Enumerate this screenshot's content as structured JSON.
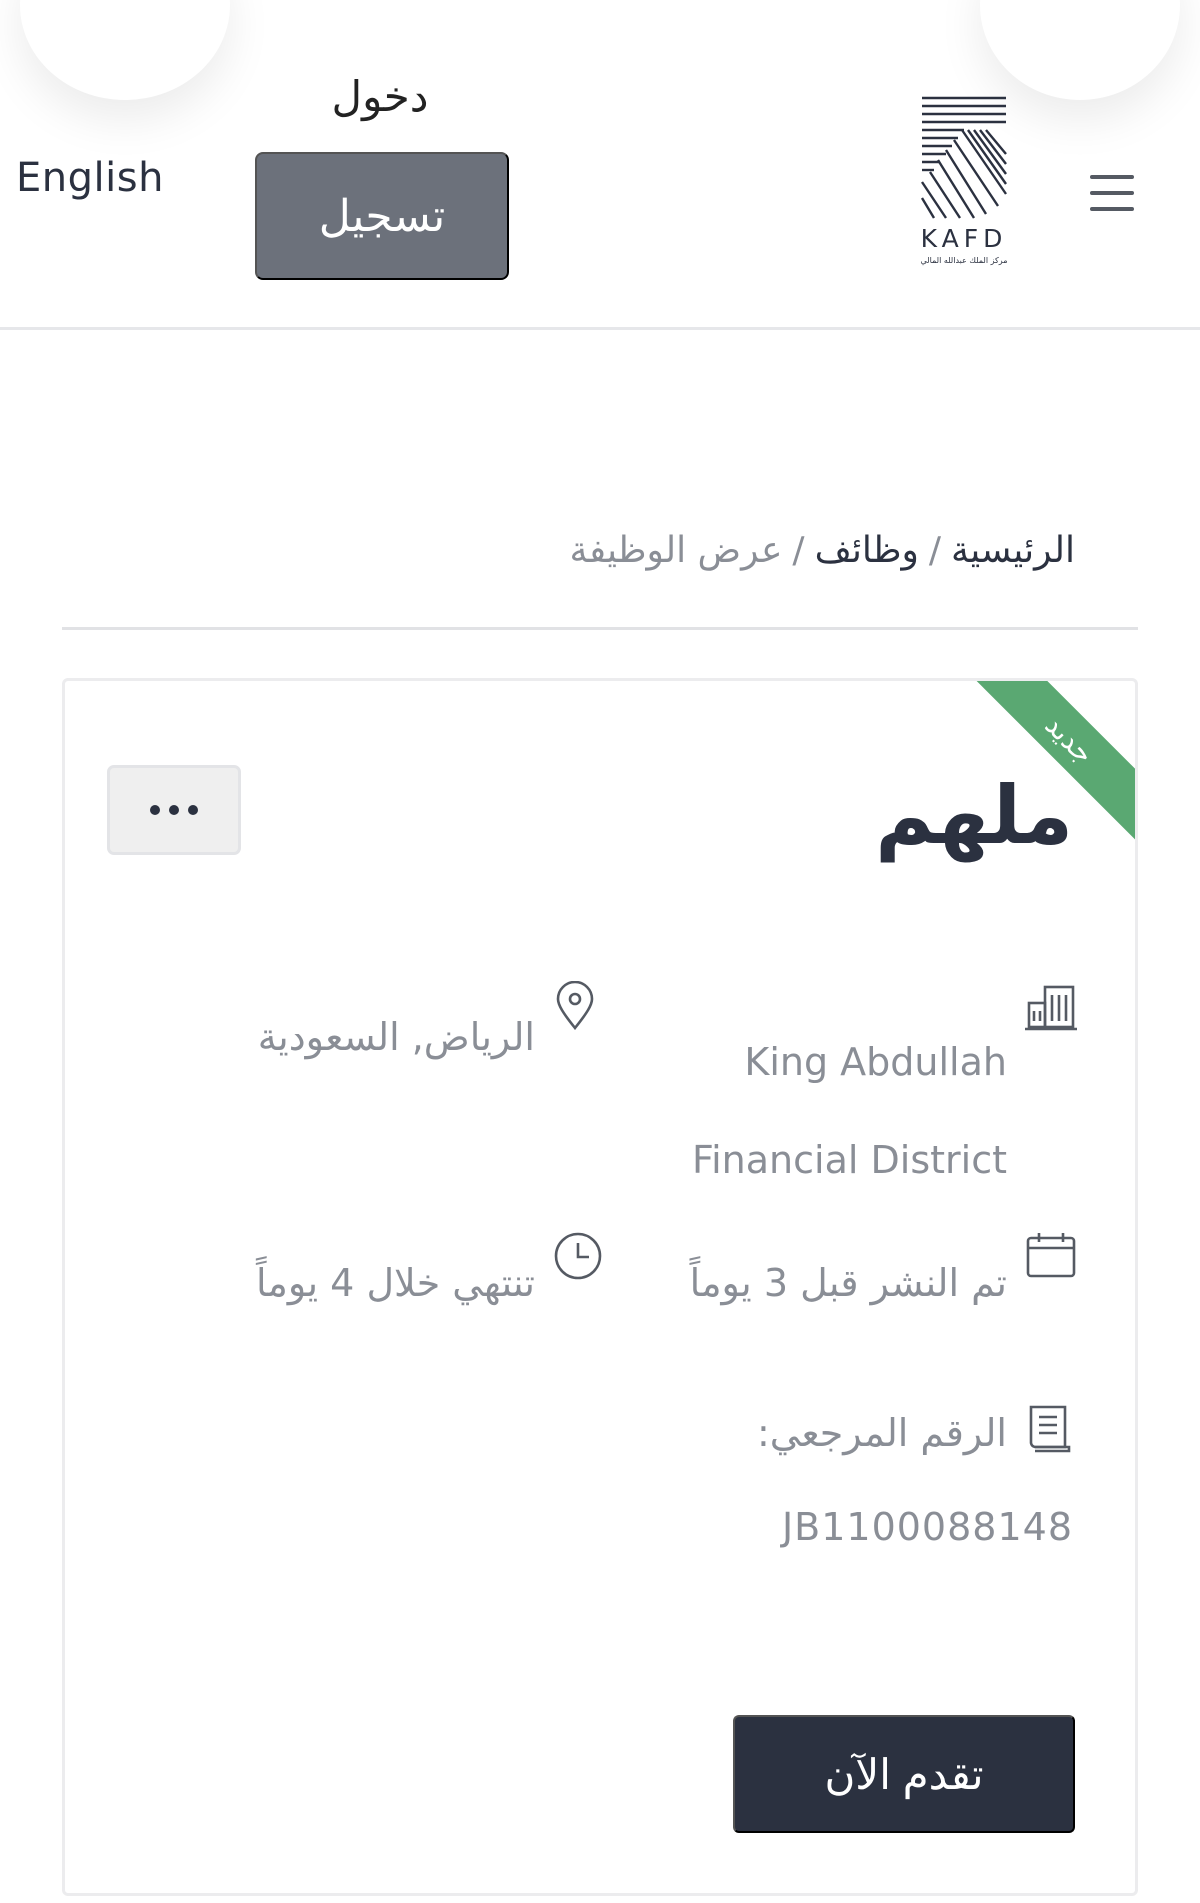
{
  "header": {
    "language_label": "English",
    "login_label": "دخول",
    "register_label": "تسجيل",
    "logo_text": "KAFD",
    "logo_subtext": "مركز الملك عبدالله المالي"
  },
  "breadcrumb": {
    "home": "الرئيسية",
    "separator": "/",
    "jobs": "وظائف",
    "current": "عرض الوظيفة"
  },
  "job": {
    "badge": "جديد",
    "title": "ملهم",
    "company": "King Abdullah Financial District",
    "location": "الرياض, السعودية",
    "posted": "تم النشر قبل 3 يوماً",
    "expires": "تنتهي خلال 4 يوماً",
    "reference_label": "الرقم المرجعي:",
    "reference_value": "JB1100088148",
    "apply_label": "تقدم الآن"
  },
  "icons": {
    "menu": "menu-icon",
    "more": "more-dots-icon",
    "company": "building-icon",
    "location": "map-pin-icon",
    "posted": "calendar-icon",
    "expires": "clock-icon",
    "reference": "document-icon"
  },
  "colors": {
    "primary_dark": "#2b3140",
    "register_button": "#6c717b",
    "badge_green": "#5aa872",
    "muted_text": "#8a8e96"
  }
}
